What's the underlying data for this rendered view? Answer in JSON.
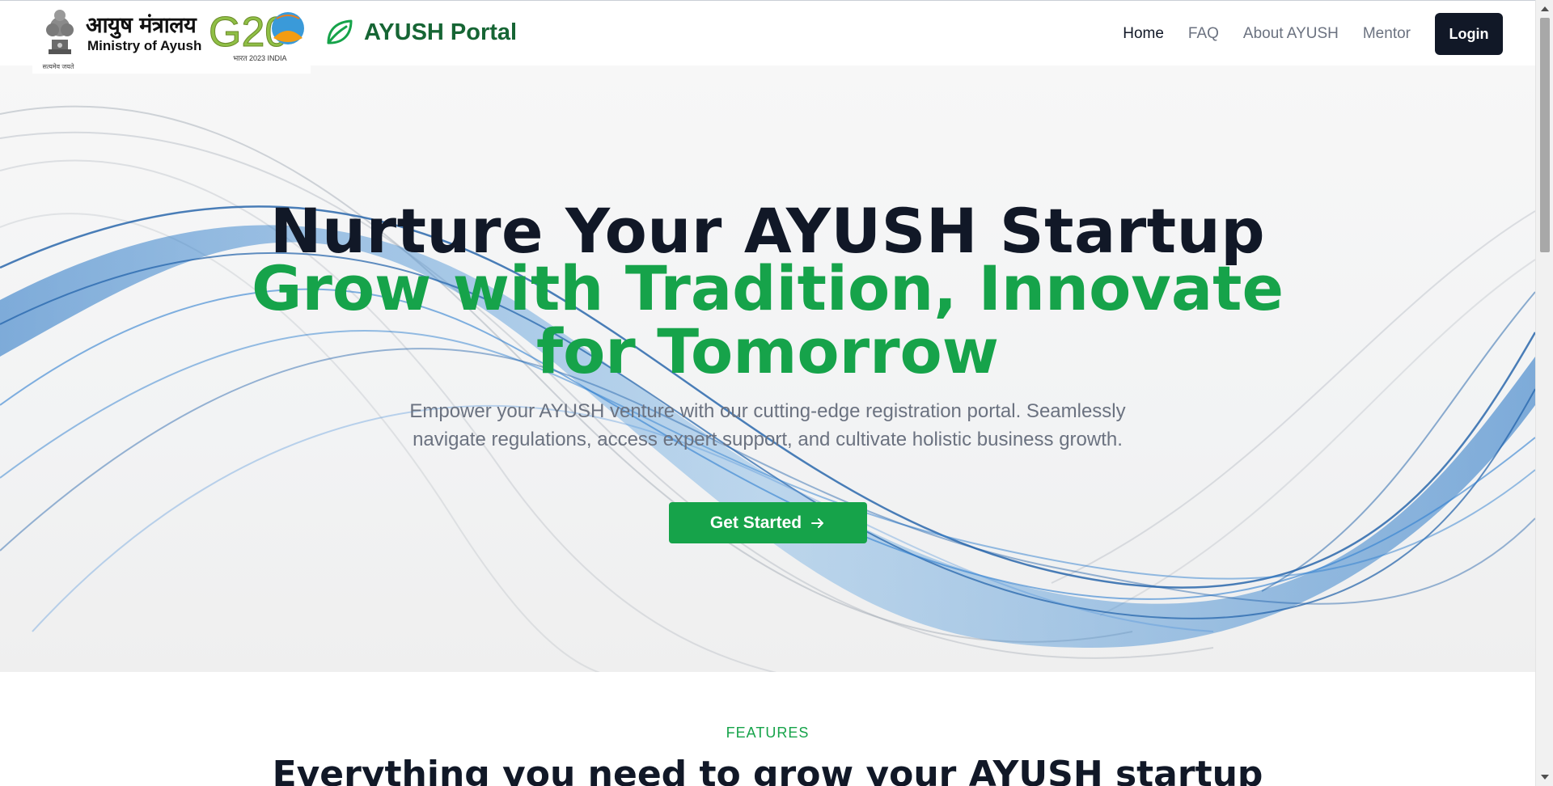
{
  "header": {
    "ministry_hindi": "आयुष मंत्रालय",
    "ministry_english": "Ministry of Ayush",
    "motto": "सत्यमेव जयते",
    "g20_text": "G20",
    "g20_caption": "भारत 2023 INDIA",
    "brand": "AYUSH Portal",
    "nav": [
      {
        "label": "Home",
        "active": true
      },
      {
        "label": "FAQ",
        "active": false
      },
      {
        "label": "About AYUSH",
        "active": false
      },
      {
        "label": "Mentor",
        "active": false
      }
    ],
    "login_label": "Login"
  },
  "hero": {
    "title": "Nurture Your AYUSH Startup",
    "subtitle": "Grow with Tradition, Innovate for Tomorrow",
    "description": "Empower your AYUSH venture with our cutting-edge registration portal. Seamlessly navigate regulations, access expert support, and cultivate holistic business growth.",
    "cta_label": "Get Started"
  },
  "features": {
    "label": "FEATURES",
    "heading": "Everything you need to grow your AYUSH startup"
  },
  "colors": {
    "brand_green": "#16a34a",
    "dark_green": "#166534",
    "navy": "#111827",
    "wave_blue": "#1d6fc2"
  },
  "icons": {
    "brand": "leaf-icon",
    "cta": "arrow-right-icon",
    "emblem": "national-emblem-icon"
  }
}
